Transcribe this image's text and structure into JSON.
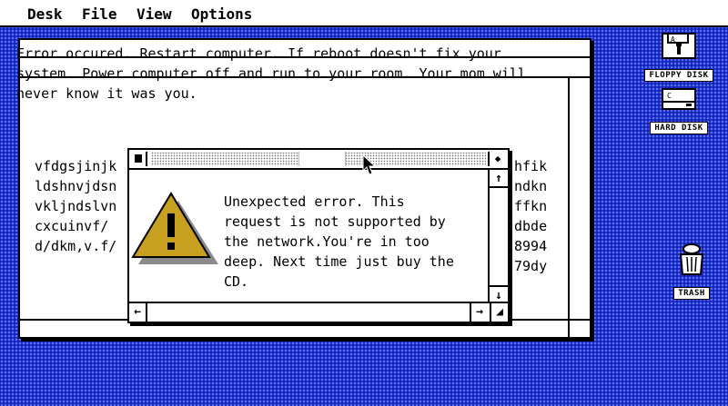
{
  "menubar": {
    "items": [
      {
        "label": "Desk"
      },
      {
        "label": "File"
      },
      {
        "label": "View"
      },
      {
        "label": "Options"
      }
    ]
  },
  "main_window": {
    "lines": [
      "Error occured. Restart computer. If reboot doesn't fix your",
      "system. Power computer off and run to your room. Your mom will",
      "never know it was you."
    ],
    "left_column": [
      "vfdgsjinjk",
      "ldshnvjdsn",
      "vkljndslvn",
      "cxcuinvf/",
      "d/dkm,v.f/"
    ],
    "right_column": [
      "hfik",
      "ndkn",
      "ffkn",
      "dbde",
      "8994",
      "79dy"
    ]
  },
  "dialog": {
    "message_lines": [
      "Unexpected error. This",
      "request is not supported by",
      "the network.You're in too",
      "deep. Next time just buy the",
      "CD."
    ],
    "icon": "warning-triangle-icon"
  },
  "desktop": {
    "icons": [
      {
        "label": "FLOPPY DISK",
        "icon": "floppy-disk-icon"
      },
      {
        "label": "HARD DISK",
        "icon": "hard-disk-icon"
      },
      {
        "label": "TRASH",
        "icon": "trash-can-icon"
      }
    ]
  },
  "colors": {
    "desktop": "#1e32d2",
    "warning_fill": "#c8a020"
  }
}
